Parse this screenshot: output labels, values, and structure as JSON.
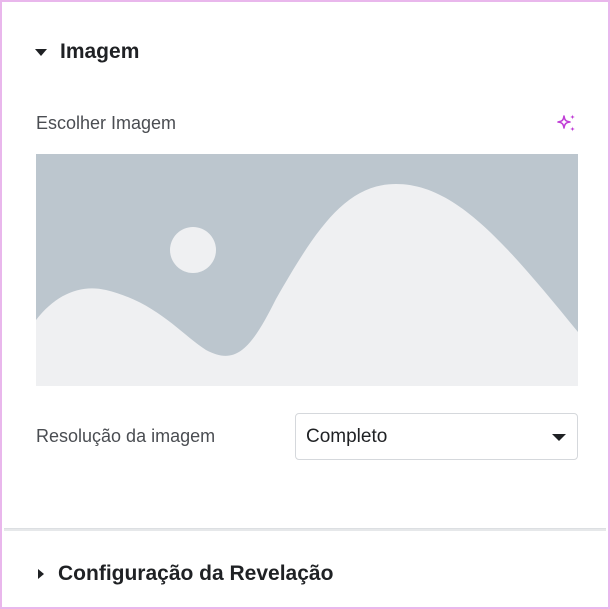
{
  "sections": {
    "image": {
      "title": "Imagem",
      "expanded": true,
      "choose_label": "Escolher Imagem",
      "resolution": {
        "label": "Resolução da imagem",
        "selected": "Completo"
      }
    },
    "reveal": {
      "title": "Configuração da Revelação",
      "expanded": false
    }
  },
  "colors": {
    "accent": "#c03fd6",
    "placeholder_bg": "#bcc6ce",
    "placeholder_fg": "#eff0f2",
    "frame_border": "#e9b7ec"
  },
  "icons": {
    "ai": "sparkles-icon",
    "placeholder": "image-placeholder-icon",
    "expand": "caret-down-icon",
    "collapse": "caret-right-icon"
  }
}
